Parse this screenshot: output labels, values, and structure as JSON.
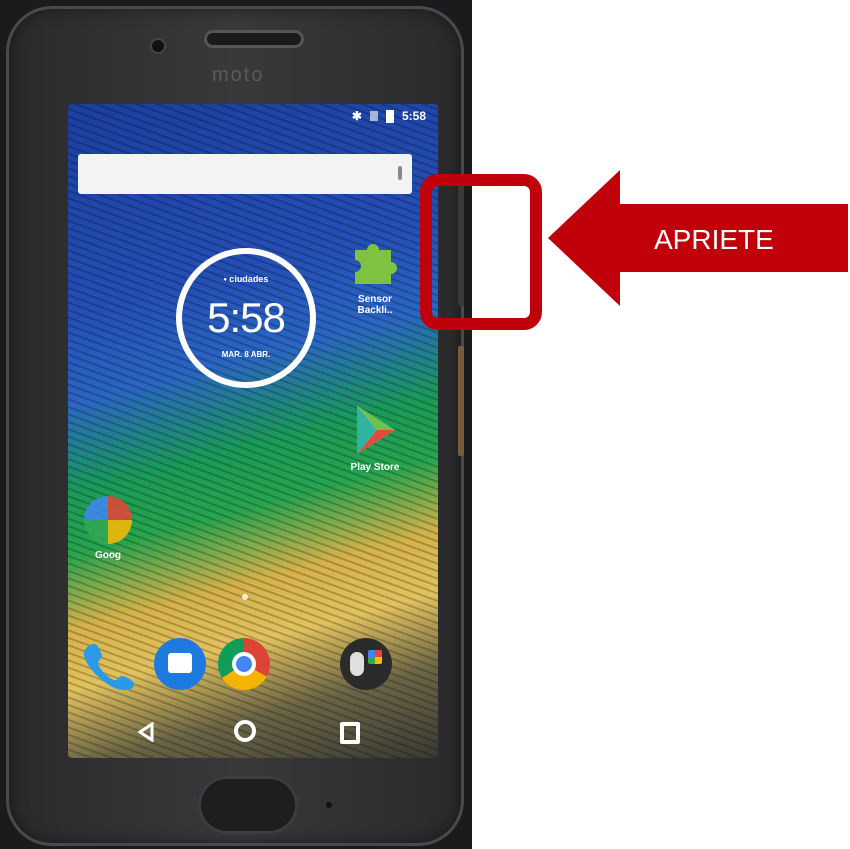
{
  "phone": {
    "brand": "moto"
  },
  "status_bar": {
    "time": "5:58"
  },
  "clock_widget": {
    "weather": "• ciudades",
    "time": "5:58",
    "date": "MAR. 8 ABR."
  },
  "apps": {
    "sensor": "Sensor Backli..",
    "play_store": "Play Store",
    "folder": "Goog"
  },
  "annotation": {
    "label": "APRIETE",
    "color": "#c0000b"
  },
  "icons": [
    "phone-icon",
    "messages-icon",
    "chrome-icon",
    "photos-icon",
    "back-icon",
    "home-icon",
    "recents-icon",
    "puzzle-icon",
    "play-store-icon"
  ]
}
